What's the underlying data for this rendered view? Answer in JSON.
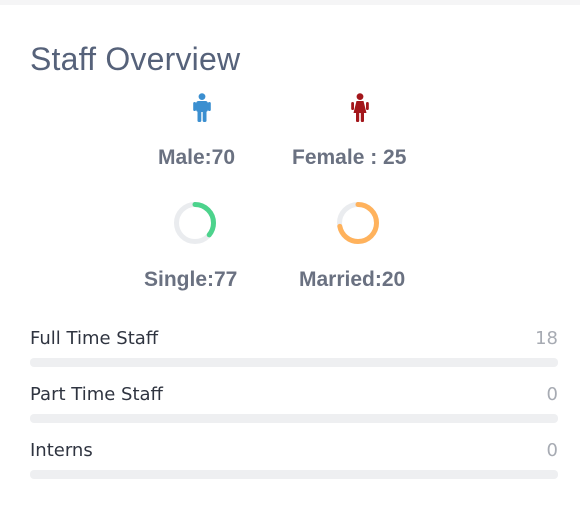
{
  "card": {
    "title": "Staff Overview"
  },
  "gender": {
    "male_label": "Male:70",
    "female_label": "Female : 25",
    "male_icon": "male-person-icon",
    "female_icon": "female-person-icon",
    "male_color": "#3b8fd0",
    "female_color": "#a3161b"
  },
  "marital": {
    "single_label": "Single:77",
    "married_label": "Married:20",
    "single_fraction": 0.36,
    "married_fraction": 0.72,
    "single_color": "#4cd38c",
    "married_color": "#ffb25c",
    "track_color": "#eaecef"
  },
  "staff_types": [
    {
      "label": "Full Time Staff",
      "value": "18",
      "fill_fraction": 0
    },
    {
      "label": "Part Time Staff",
      "value": "0",
      "fill_fraction": 0
    },
    {
      "label": "Interns",
      "value": "0",
      "fill_fraction": 0
    }
  ]
}
